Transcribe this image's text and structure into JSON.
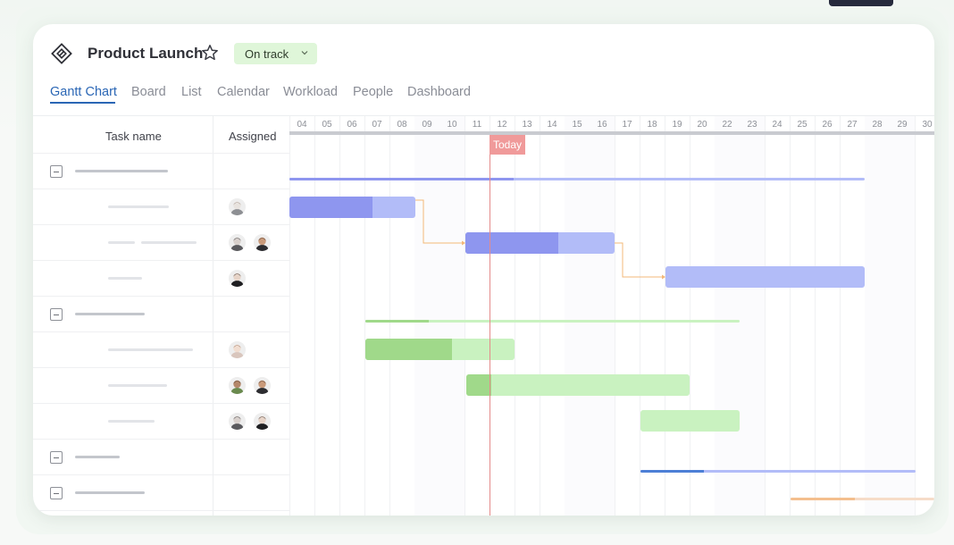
{
  "project": {
    "title": "Product Launch",
    "status": "On track"
  },
  "tabs": [
    "Gantt Chart",
    "Board",
    "List",
    "Calendar",
    "Workload",
    "People",
    "Dashboard"
  ],
  "active_tab": "Gantt Chart",
  "columns": {
    "task": "Task name",
    "assigned": "Assigned"
  },
  "days": [
    "04",
    "05",
    "06",
    "07",
    "08",
    "09",
    "10",
    "11",
    "12",
    "13",
    "14",
    "15",
    "16",
    "17",
    "18",
    "19",
    "20",
    "22",
    "23",
    "24",
    "25",
    "26",
    "27",
    "28",
    "29",
    "30"
  ],
  "today_label": "Today",
  "colors": {
    "accent": "#2a66b5",
    "status_bg": "#dff6d9",
    "today": "#f09a9a",
    "purple_dark": "#8e96ef",
    "purple_light": "#b2bcf8",
    "green_dark": "#a0d98a",
    "green_light": "#c9f2c0",
    "blue_dark": "#4d7fd6",
    "orange": "#f4bf8e"
  },
  "rows": [
    {
      "type": "group",
      "placeholder": "dark"
    },
    {
      "type": "task",
      "placeholder": "light",
      "avatars": [
        "person-avatar"
      ]
    },
    {
      "type": "task",
      "placeholder": "light",
      "avatars": [
        "person-avatar",
        "person-avatar"
      ]
    },
    {
      "type": "task",
      "placeholder": "light",
      "avatars": [
        "person-avatar"
      ]
    },
    {
      "type": "group",
      "placeholder": "dark"
    },
    {
      "type": "task",
      "placeholder": "light",
      "avatars": [
        "person-avatar"
      ]
    },
    {
      "type": "task",
      "placeholder": "light",
      "avatars": [
        "person-avatar",
        "person-avatar"
      ]
    },
    {
      "type": "task",
      "placeholder": "light",
      "avatars": [
        "person-avatar",
        "person-avatar"
      ]
    },
    {
      "type": "group",
      "placeholder": "dark"
    },
    {
      "type": "group",
      "placeholder": "dark"
    }
  ]
}
